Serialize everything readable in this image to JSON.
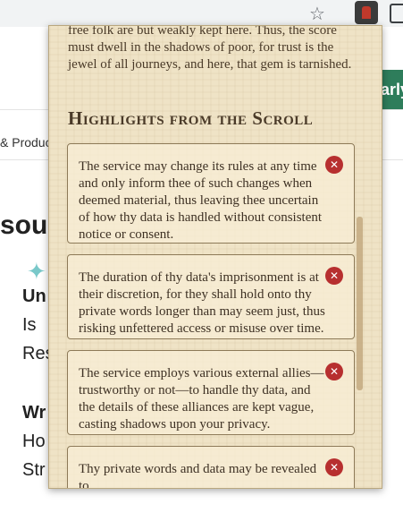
{
  "page": {
    "partial_button": "arly",
    "partial_nav": "& Produc",
    "partial_heading": "sou",
    "partial_lines": [
      "Un",
      "Is",
      "Res",
      "Wr",
      "Ho",
      "Str"
    ]
  },
  "popup": {
    "intro_text": "free folk are but weakly kept here. Thus, the score must dwell in the shadows of poor, for trust is the jewel of all journeys, and here, that gem is tarnished.",
    "section_title": "Highlights from the Scroll",
    "highlights": [
      {
        "text": "The service may change its rules at any time and only inform thee of such changes when deemed material, thus leaving thee uncertain of how thy data is handled without consistent notice or consent."
      },
      {
        "text": "The duration of thy data's imprisonment is at their discretion, for they shall hold onto thy private words longer than may seem just, thus risking unfettered access or misuse over time."
      },
      {
        "text": "The service employs various external allies—trustworthy or not—to handle thy data, and the details of these alliances are kept vague, casting shadows upon your privacy."
      },
      {
        "text": "Thy private words and data may be revealed to"
      }
    ],
    "close_glyph": "✕"
  }
}
